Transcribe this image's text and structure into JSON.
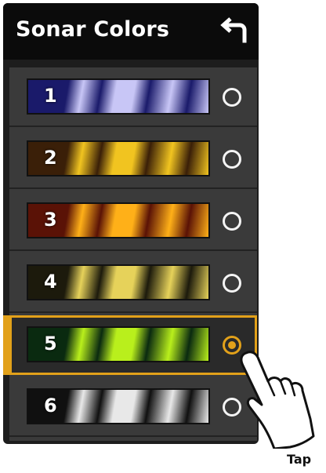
{
  "header": {
    "title": "Sonar Colors",
    "back_icon": "back-arrow-icon"
  },
  "palettes": [
    {
      "label": "1",
      "selected": false,
      "bg": "#1a1a6a",
      "fg": "#c8c6f6"
    },
    {
      "label": "2",
      "selected": false,
      "bg": "#3a1f08",
      "fg": "#f1c420"
    },
    {
      "label": "3",
      "selected": false,
      "bg": "#5a1206",
      "fg": "#ffb018"
    },
    {
      "label": "4",
      "selected": false,
      "bg": "#1c1a0c",
      "fg": "#e6d25a"
    },
    {
      "label": "5",
      "selected": true,
      "bg": "#0a2a10",
      "fg": "#b9ef1c"
    },
    {
      "label": "6",
      "selected": false,
      "bg": "#101010",
      "fg": "#e8e8e8"
    }
  ],
  "colors": {
    "accent": "#e2a11a",
    "panel": "#1d1d1d",
    "row": "#3a3a3a"
  },
  "annotation": {
    "tap_label": "Tap",
    "hand_icon": "tap-hand-icon"
  }
}
